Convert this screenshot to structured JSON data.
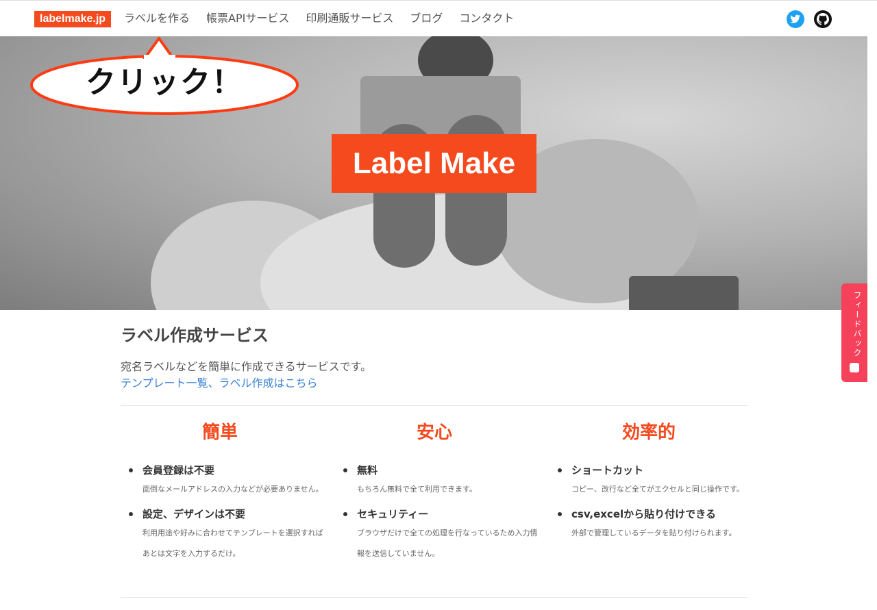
{
  "nav": {
    "brand": "labelmake.jp",
    "links": [
      "ラベルを作る",
      "帳票APIサービス",
      "印刷通販サービス",
      "ブログ",
      "コンタクト"
    ],
    "social": [
      "twitter-icon",
      "github-icon"
    ]
  },
  "callout": {
    "text": "クリック！"
  },
  "hero": {
    "title": "Label Make"
  },
  "feedback": {
    "label": "フィードバック"
  },
  "section": {
    "title": "ラベル作成サービス",
    "description": "宛名ラベルなどを簡単に作成できるサービスです。",
    "link": "テンプレート一覧、ラベル作成はこちら"
  },
  "features": [
    {
      "heading": "簡単",
      "items": [
        {
          "title": "会員登録は不要",
          "desc": "面倒なメールアドレスの入力などが必要ありません。"
        },
        {
          "title": "設定、デザインは不要",
          "desc": "利用用途や好みに合わせてテンプレートを選択すればあとは文字を入力するだけ。"
        }
      ]
    },
    {
      "heading": "安心",
      "items": [
        {
          "title": "無料",
          "desc": "もちろん無料で全て利用できます。"
        },
        {
          "title": "セキュリティー",
          "desc": "ブラウザだけで全ての処理を行なっているため入力情報を送信していません。"
        }
      ]
    },
    {
      "heading": "効率的",
      "items": [
        {
          "title": "ショートカット",
          "desc": "コピー、改行など全てがエクセルと同じ操作です。"
        },
        {
          "title": "csv,excelから貼り付けできる",
          "desc": "外部で管理しているデータを貼り付けられます。"
        }
      ]
    }
  ],
  "colors": {
    "brand": "#f44a1e",
    "link": "#3b82d6",
    "twitter": "#1da1f2",
    "feedback": "#f5415a",
    "callout_border": "#ff3b14"
  }
}
